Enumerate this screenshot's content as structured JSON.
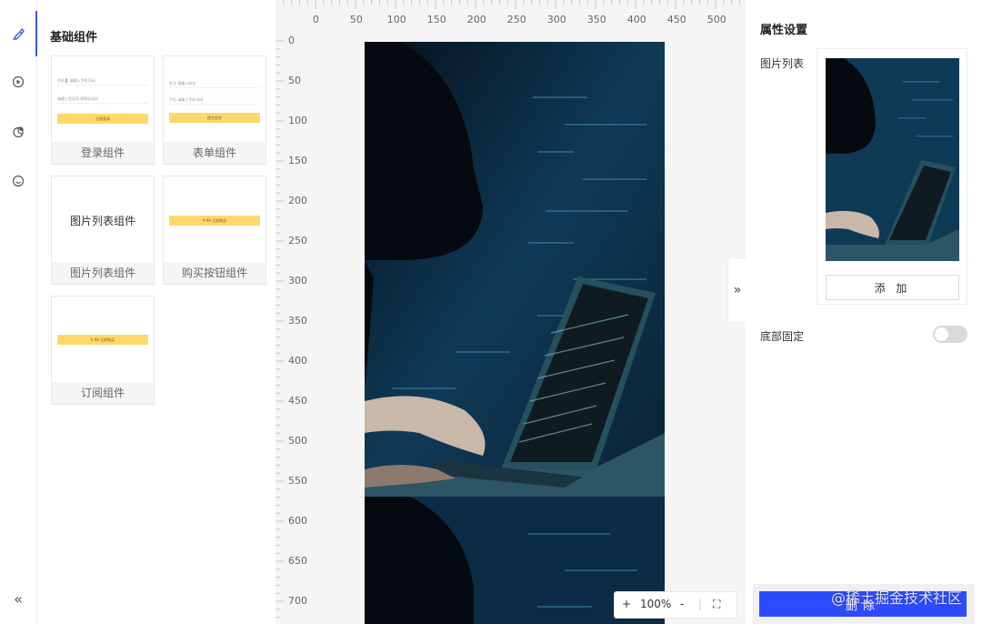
{
  "sidebar": {
    "collapse_icon": "«",
    "items": [
      {
        "icon": "brush-icon",
        "active": true
      },
      {
        "icon": "play-circle-icon"
      },
      {
        "icon": "pie-chart-icon"
      },
      {
        "icon": "smile-icon"
      }
    ]
  },
  "components_panel": {
    "title": "基础组件",
    "cards": [
      {
        "label": "登录组件",
        "rows": [
          "手机  ▌ 请输入手机号码",
          "请输入验证码       获取验证码"
        ],
        "button": "立即登录"
      },
      {
        "label": "表单组件",
        "rows": [
          "姓名    请输入姓名",
          "手机    请输入手机号码"
        ],
        "button": "提交信息"
      },
      {
        "label": "图片列表组件",
        "preview_text": "图片列表组件"
      },
      {
        "label": "购买按钮组件",
        "button": "¥ 99 立即购买"
      },
      {
        "label": "订阅组件",
        "button": "¥ 99 立即购买"
      }
    ]
  },
  "ruler": {
    "h": [
      "0",
      "50",
      "100",
      "150",
      "200",
      "250",
      "300",
      "350",
      "400",
      "450",
      "500"
    ],
    "v": [
      "0",
      "50",
      "100",
      "150",
      "200",
      "250",
      "300",
      "350",
      "400",
      "450",
      "500",
      "550",
      "600",
      "650",
      "700"
    ]
  },
  "zoom": {
    "plus": "+",
    "level": "100%",
    "minus": "-",
    "fullscreen_icon": "⛶"
  },
  "collapse_tab": "»",
  "properties": {
    "title": "属性设置",
    "image_list_label": "图片列表",
    "add_label": "添 加",
    "fixed_bottom_label": "底部固定",
    "fixed_bottom_on": false,
    "delete_label": "删除"
  },
  "watermark": "@稀土掘金技术社区",
  "colors": {
    "accent": "#3b5bdb",
    "primary_button": "#2f4bff",
    "yellow_button": "#ffd86b",
    "image_bg": "#0b2c44"
  }
}
